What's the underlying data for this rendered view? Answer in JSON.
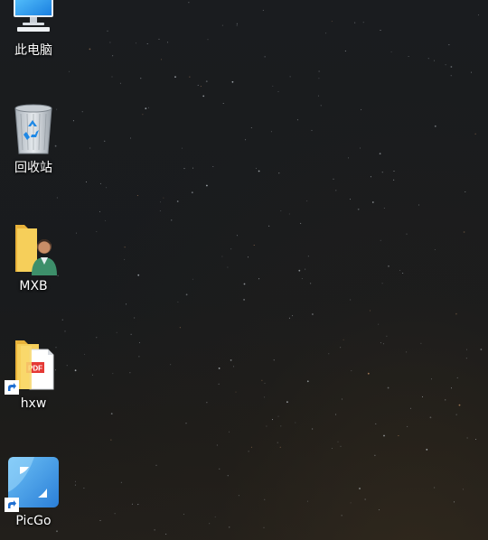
{
  "desktop": {
    "icons": [
      {
        "label": "此电脑",
        "icon": "computer-icon",
        "shortcut": false
      },
      {
        "label": "回收站",
        "icon": "recycle-bin-icon",
        "shortcut": false
      },
      {
        "label": "MXB",
        "icon": "user-folder-icon",
        "shortcut": false
      },
      {
        "label": "hxw",
        "icon": "pdf-folder-icon",
        "shortcut": true
      },
      {
        "label": "PicGo",
        "icon": "picgo-app-icon",
        "shortcut": true
      }
    ]
  },
  "colors": {
    "wallpaper": "#1a1c1f",
    "label_text": "#ffffff",
    "folder": "#f4c449",
    "picgo": "#3a8fe0"
  }
}
